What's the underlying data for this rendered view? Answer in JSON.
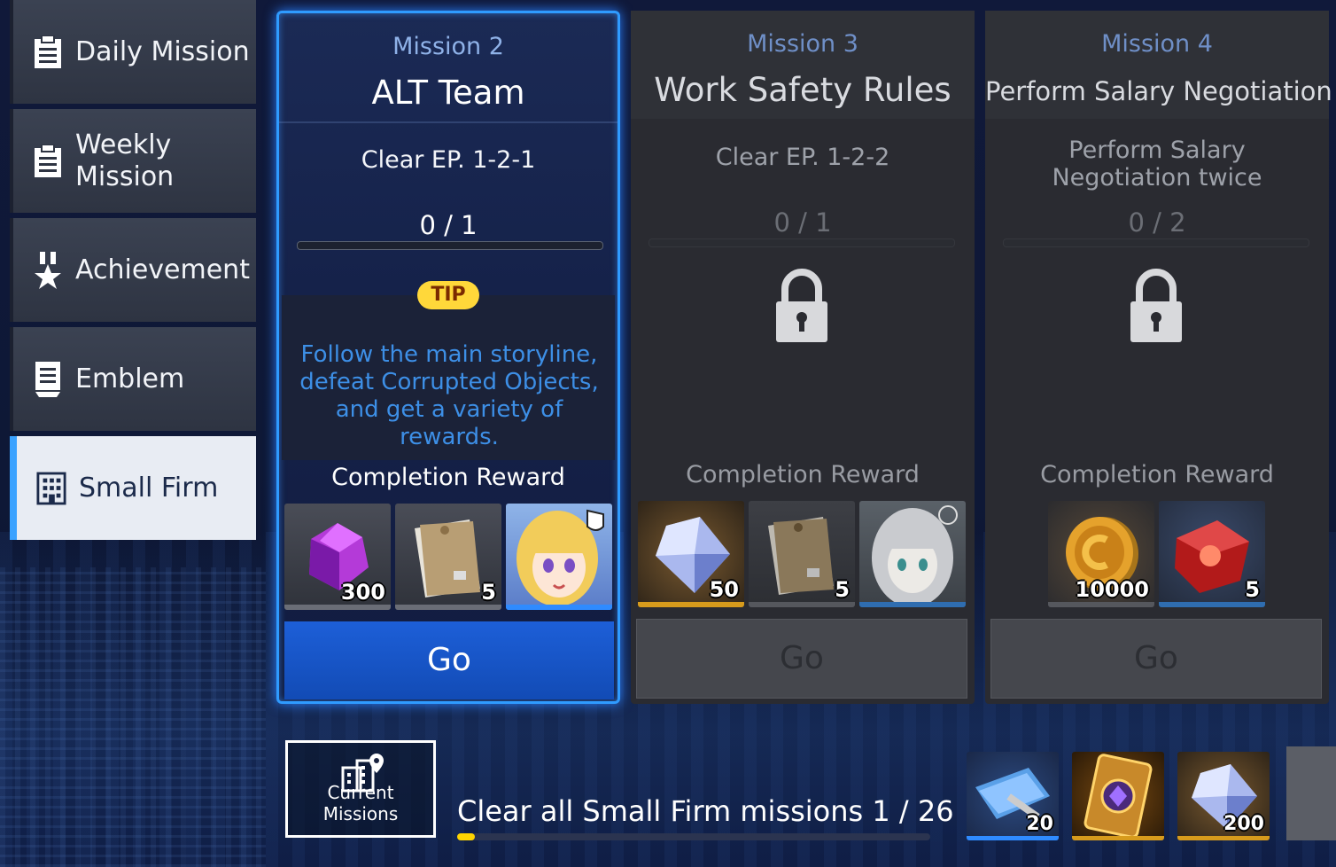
{
  "sidebar": {
    "items": [
      {
        "label": "Daily Mission",
        "icon": "clipboard-icon",
        "active": false
      },
      {
        "label": "Weekly\nMission",
        "icon": "clipboard-icon",
        "active": false
      },
      {
        "label": "Achievement",
        "icon": "medal-icon",
        "active": false
      },
      {
        "label": "Emblem",
        "icon": "emblem-icon",
        "active": false
      },
      {
        "label": "Small Firm",
        "icon": "building-icon",
        "active": true
      }
    ]
  },
  "missions": [
    {
      "number": "Mission 2",
      "title": "ALT Team",
      "goal": "Clear EP. 1-2-1",
      "progress": "0 / 1",
      "progress_fraction": 0,
      "tip_label": "TIP",
      "tip_text": "Follow the main storyline, defeat Corrupted Objects, and get a variety of rewards.",
      "reward_title": "Completion Reward",
      "rewards": [
        {
          "icon": "purple-crystal-icon",
          "qty": "300"
        },
        {
          "icon": "exp-envelope-icon",
          "qty": "5"
        },
        {
          "icon": "character-portrait-blonde",
          "qty": ""
        }
      ],
      "go_label": "Go",
      "locked": false
    },
    {
      "number": "Mission 3",
      "title": "Work Safety Rules",
      "goal": "Clear EP. 1-2-2",
      "progress": "0 / 1",
      "progress_fraction": 0,
      "reward_title": "Completion Reward",
      "rewards": [
        {
          "icon": "blue-diamond-icon",
          "qty": "50"
        },
        {
          "icon": "exp-envelope-icon",
          "qty": "5"
        },
        {
          "icon": "character-portrait-silver",
          "qty": ""
        }
      ],
      "go_label": "Go",
      "locked": true
    },
    {
      "number": "Mission 4",
      "title": "Perform Salary Negotiation",
      "goal": "Perform Salary Negotiation twice",
      "progress": "0 / 2",
      "progress_fraction": 0,
      "reward_title": "Completion Reward",
      "rewards": [
        {
          "icon": "gold-coin-icon",
          "qty": "10000"
        },
        {
          "icon": "red-cube-icon",
          "qty": "5"
        }
      ],
      "go_label": "Go",
      "locked": true
    }
  ],
  "bottom": {
    "current_missions_label": "Current Missions",
    "clear_text": "Clear all Small Firm missions  1 / 26",
    "clear_fraction": 0.038,
    "rewards": [
      {
        "icon": "blueprint-wrench-icon",
        "qty": "20"
      },
      {
        "icon": "golden-card-icon",
        "qty": ""
      },
      {
        "icon": "blue-diamond-icon",
        "qty": "200"
      }
    ]
  },
  "colors": {
    "accent_blue": "#2f9bff",
    "go_button": "#1d5fd8",
    "tip_yellow": "#ffd83a",
    "tip_text": "#3d8fe6",
    "progress_fill": "#ffd400"
  }
}
